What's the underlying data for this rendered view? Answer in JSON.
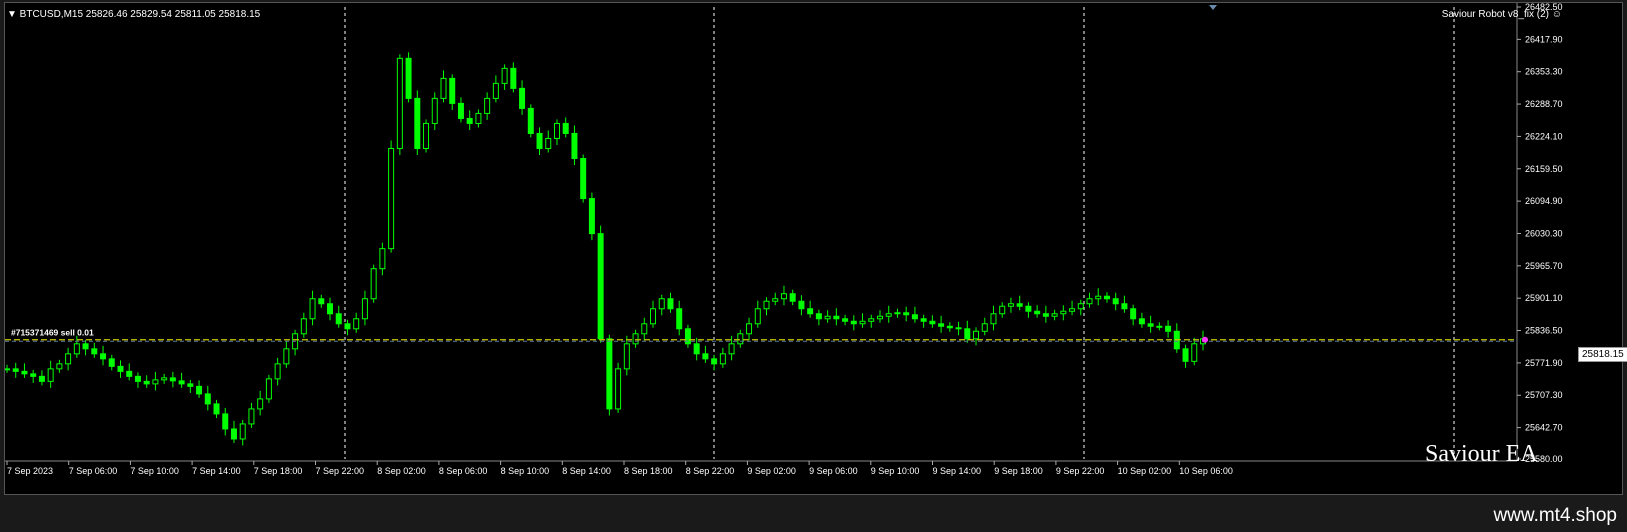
{
  "header": {
    "symbol_line": "▼ BTCUSD,M15  25826.46 25829.54 25811.05 25818.15",
    "ea_title": "Saviour Robot v8_fix (2) ☺"
  },
  "order_label": "#715371469 sell 0.01",
  "watermark": "Saviour EA",
  "footer_brand": "www.mt4.shop",
  "current_price_tag": "25818.15",
  "colors": {
    "background": "#000000",
    "candle": "#00ff00",
    "grid": "#ffffff",
    "bid_line": "#c8c800",
    "ask_line": "#5a7a9a",
    "axis_text": "#ffffff",
    "marker": "#ff33ff"
  },
  "chart_data": {
    "type": "line",
    "symbol": "BTCUSD",
    "timeframe": "M15",
    "x_tick_labels": [
      "7 Sep 2023",
      "7 Sep 06:00",
      "7 Sep 10:00",
      "7 Sep 14:00",
      "7 Sep 18:00",
      "7 Sep 22:00",
      "8 Sep 02:00",
      "8 Sep 06:00",
      "8 Sep 10:00",
      "8 Sep 14:00",
      "8 Sep 18:00",
      "8 Sep 22:00",
      "9 Sep 02:00",
      "9 Sep 06:00",
      "9 Sep 10:00",
      "9 Sep 14:00",
      "9 Sep 18:00",
      "9 Sep 22:00",
      "10 Sep 02:00",
      "10 Sep 06:00"
    ],
    "y_tick_labels": [
      "26482.50",
      "26417.90",
      "26353.30",
      "26288.70",
      "26224.10",
      "26159.50",
      "26094.90",
      "26030.30",
      "25965.70",
      "25901.10",
      "25836.50",
      "25771.90",
      "25707.30",
      "25642.70",
      "25580.00"
    ],
    "ylim": [
      25580.0,
      26482.5
    ],
    "day_separators": [
      "8 Sep 2023",
      "9 Sep 2023",
      "10 Sep 2023",
      "11 Sep 2023"
    ],
    "bid_price": 25818.15,
    "series": [
      {
        "values": [
          25760,
          25755,
          25750,
          25745,
          25735,
          25760,
          25770,
          25790,
          25810,
          25800,
          25790,
          25780,
          25765,
          25755,
          25745,
          25735,
          25730,
          25738,
          25742,
          25736,
          25730,
          25725,
          25710,
          25690,
          25670,
          25640,
          25620,
          25650,
          25680,
          25700,
          25740,
          25770,
          25800,
          25830,
          25860,
          25900,
          25890,
          25870,
          25850,
          25840,
          25860,
          25900,
          25960,
          26000,
          26200,
          26380,
          26300,
          26200,
          26250,
          26300,
          26340,
          26290,
          26260,
          26250,
          26270,
          26300,
          26330,
          26360,
          26320,
          26280,
          26230,
          26200,
          26220,
          26250,
          26230,
          26180,
          26100,
          26030,
          25820,
          25680,
          25760,
          25810,
          25830,
          25850,
          25880,
          25900,
          25880,
          25840,
          25810,
          25790,
          25780,
          25770,
          25790,
          25810,
          25830,
          25850,
          25880,
          25895,
          25900,
          25910,
          25895,
          25880,
          25870,
          25860,
          25865,
          25860,
          25855,
          25850,
          25855,
          25860,
          25865,
          25870,
          25872,
          25868,
          25860,
          25855,
          25850,
          25845,
          25842,
          25840,
          25820,
          25835,
          25850,
          25870,
          25885,
          25890,
          25885,
          25875,
          25870,
          25865,
          25870,
          25875,
          25880,
          25890,
          25900,
          25905,
          25900,
          25890,
          25880,
          25860,
          25850,
          25845,
          25845,
          25835,
          25800,
          25775,
          25810,
          25820
        ]
      }
    ]
  }
}
